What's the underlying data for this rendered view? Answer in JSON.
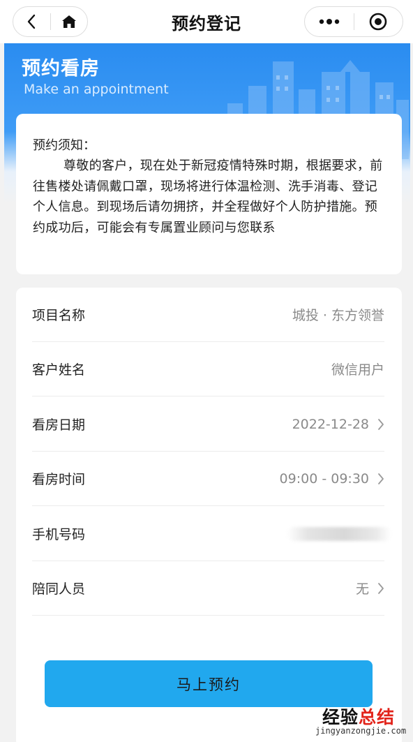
{
  "nav": {
    "title": "预约登记",
    "back_icon": "chevron-left-icon",
    "home_icon": "home-icon",
    "more_icon": "more-dots-icon",
    "close_icon": "target-circle-icon"
  },
  "banner": {
    "title": "预约看房",
    "subtitle": "Make an appointment"
  },
  "notice": {
    "heading": "预约须知：",
    "body": "尊敬的客户，现在处于新冠疫情特殊时期，根据要求，前往售楼处请佩戴口罩，现场将进行体温检测、洗手消毒、登记个人信息。到现场后请勿拥挤，并全程做好个人防护措施。预约成功后，可能会有专属置业顾问与您联系"
  },
  "form": {
    "rows": [
      {
        "label": "项目名称",
        "value": "城投 · 东方领誉",
        "has_chevron": false
      },
      {
        "label": "客户姓名",
        "value": "微信用户",
        "has_chevron": false
      },
      {
        "label": "看房日期",
        "value": "2022-12-28",
        "has_chevron": true
      },
      {
        "label": "看房时间",
        "value": "09:00 - 09:30",
        "has_chevron": true
      },
      {
        "label": "手机号码",
        "value": "",
        "has_chevron": false
      },
      {
        "label": "陪同人员",
        "value": "无",
        "has_chevron": true
      }
    ],
    "submit_label": "马上预约"
  },
  "watermark": {
    "text_main": "经验",
    "text_accent": "总结",
    "url": "jingyanzongjie.com"
  },
  "colors": {
    "brand_blue": "#2a8cf0",
    "button_blue": "#21a8ee",
    "watermark_red": "#e2231a"
  }
}
